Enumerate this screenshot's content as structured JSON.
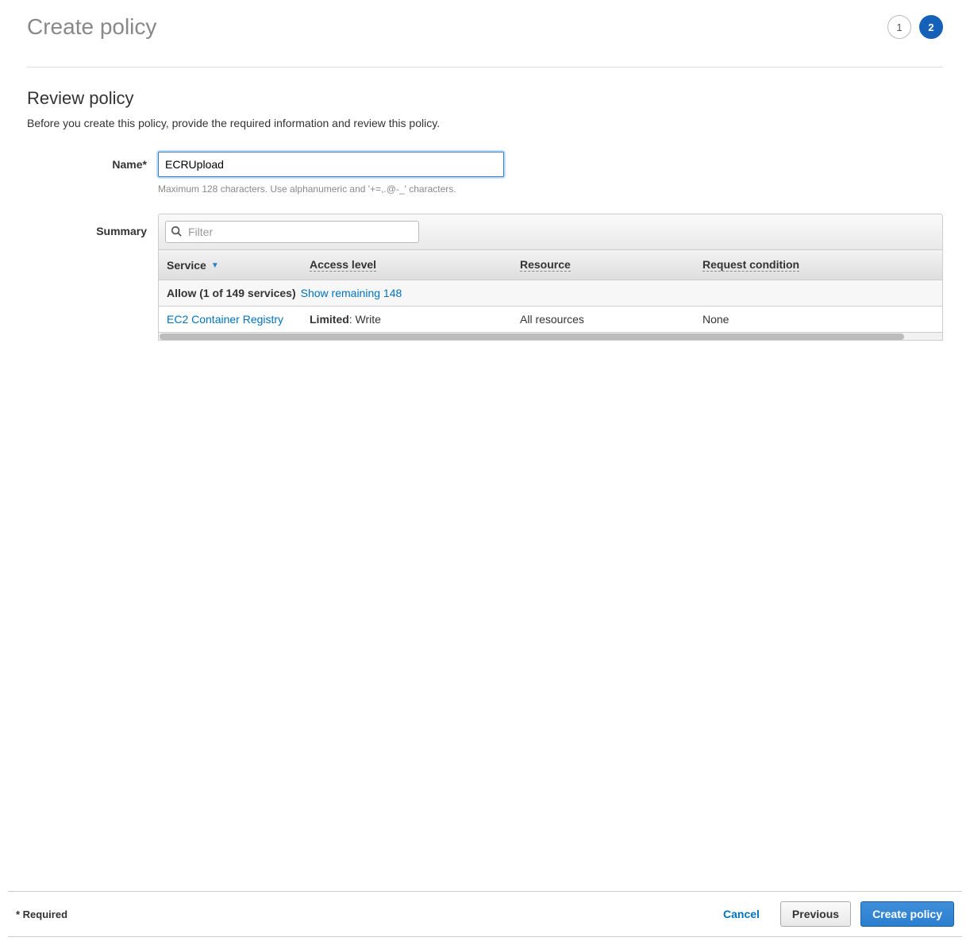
{
  "header": {
    "title": "Create policy",
    "steps": [
      "1",
      "2"
    ],
    "active_step_index": 1
  },
  "review": {
    "title": "Review policy",
    "description": "Before you create this policy, provide the required information and review this policy."
  },
  "name_field": {
    "label": "Name*",
    "value": "ECRUpload",
    "hint": "Maximum 128 characters. Use alphanumeric and '+=,.@-_' characters."
  },
  "summary": {
    "label": "Summary",
    "filter_placeholder": "Filter",
    "columns": {
      "service": "Service",
      "access_level": "Access level",
      "resource": "Resource",
      "request_condition": "Request condition"
    },
    "allow_row": {
      "bold": "Allow (1 of 149 services)",
      "link": "Show remaining 148"
    },
    "rows": [
      {
        "service": "EC2 Container Registry",
        "access_bold": "Limited",
        "access_rest": ": Write",
        "resource": "All resources",
        "request_condition": "None"
      }
    ]
  },
  "footer": {
    "required": "* Required",
    "cancel": "Cancel",
    "previous": "Previous",
    "create": "Create policy"
  }
}
